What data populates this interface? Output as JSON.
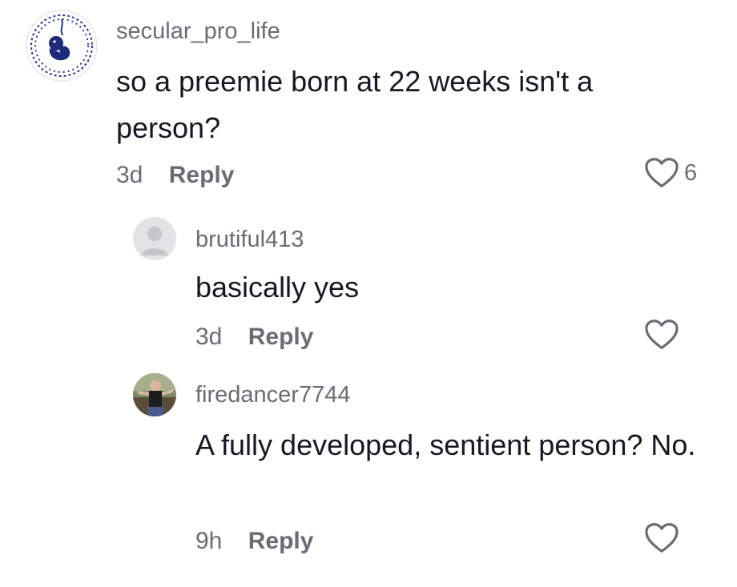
{
  "comments": [
    {
      "username": "secular_pro_life",
      "text": "so a preemie born at 22 weeks isn't a person?",
      "time": "3d",
      "reply_label": "Reply",
      "likes": "6",
      "avatar_icon": "fetus-dna-logo-icon"
    },
    {
      "username": "brutiful413",
      "text": "basically yes",
      "time": "3d",
      "reply_label": "Reply",
      "likes": "",
      "avatar_icon": "default-avatar-icon"
    },
    {
      "username": "firedancer7744",
      "text": "A fully developed, sentient person? No.",
      "time": "9h",
      "reply_label": "Reply",
      "likes": "",
      "avatar_icon": "user-photo-avatar"
    }
  ],
  "colors": {
    "muted_text": "#6b6c73",
    "primary_text": "#161823",
    "logo_blue": "#1e2a7a"
  }
}
